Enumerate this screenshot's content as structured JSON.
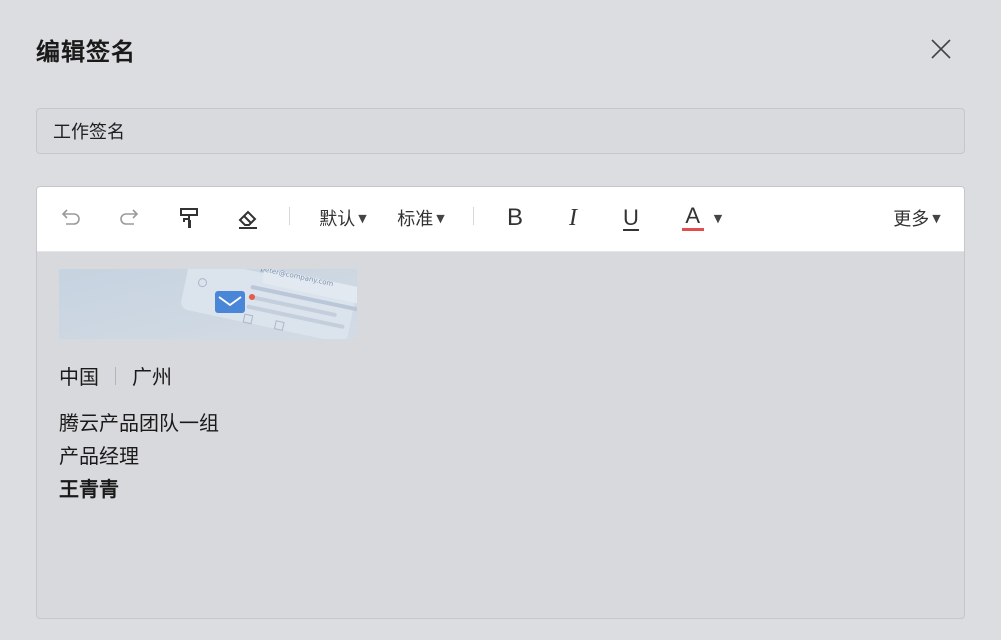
{
  "dialog": {
    "title": "编辑签名",
    "close_icon": "close-icon"
  },
  "signature_name": {
    "value": "工作签名"
  },
  "toolbar": {
    "font_label": "默认",
    "size_label": "标准",
    "bold_label": "B",
    "italic_label": "I",
    "underline_label": "U",
    "color_label": "A",
    "more_label": "更多",
    "icons": [
      "undo-icon",
      "redo-icon",
      "format-painter-icon",
      "eraser-icon",
      "caret-down-icon"
    ],
    "accent_color": "#e34d4d"
  },
  "signature": {
    "banner_email": "peter@company.com",
    "country": "中国",
    "city": "广州",
    "team": "腾云产品团队一组",
    "role": "产品经理",
    "name": "王青青"
  }
}
